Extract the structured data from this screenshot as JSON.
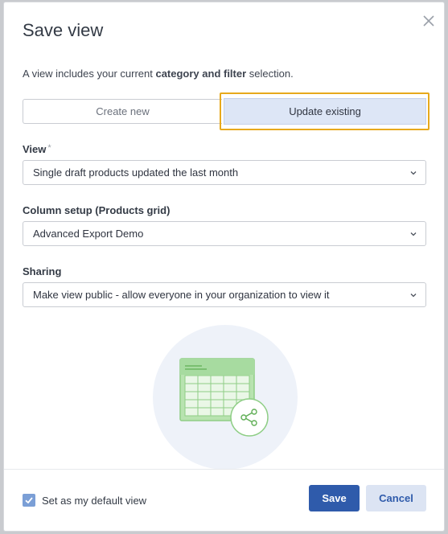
{
  "dialog": {
    "title": "Save view",
    "description_prefix": "A view includes your current ",
    "description_bold": "category and filter",
    "description_suffix": " selection."
  },
  "mode_toggle": {
    "options": [
      "Create new",
      "Update existing"
    ],
    "selected": "Update existing"
  },
  "fields": {
    "view": {
      "label": "View",
      "required_marker": "*",
      "value": "Single draft products updated the last month"
    },
    "column_setup": {
      "label": "Column setup (Products grid)",
      "value": "Advanced Export Demo"
    },
    "sharing": {
      "label": "Sharing",
      "value": "Make view public - allow everyone in your organization to view it"
    }
  },
  "footer": {
    "default_checkbox_label": "Set as my default view",
    "default_checked": true,
    "save_label": "Save",
    "cancel_label": "Cancel"
  },
  "colors": {
    "primary": "#2f5bab",
    "highlight_outline": "#e7a91c",
    "illustration_green": "#8fce86",
    "illustration_circle": "#eef2f9"
  }
}
